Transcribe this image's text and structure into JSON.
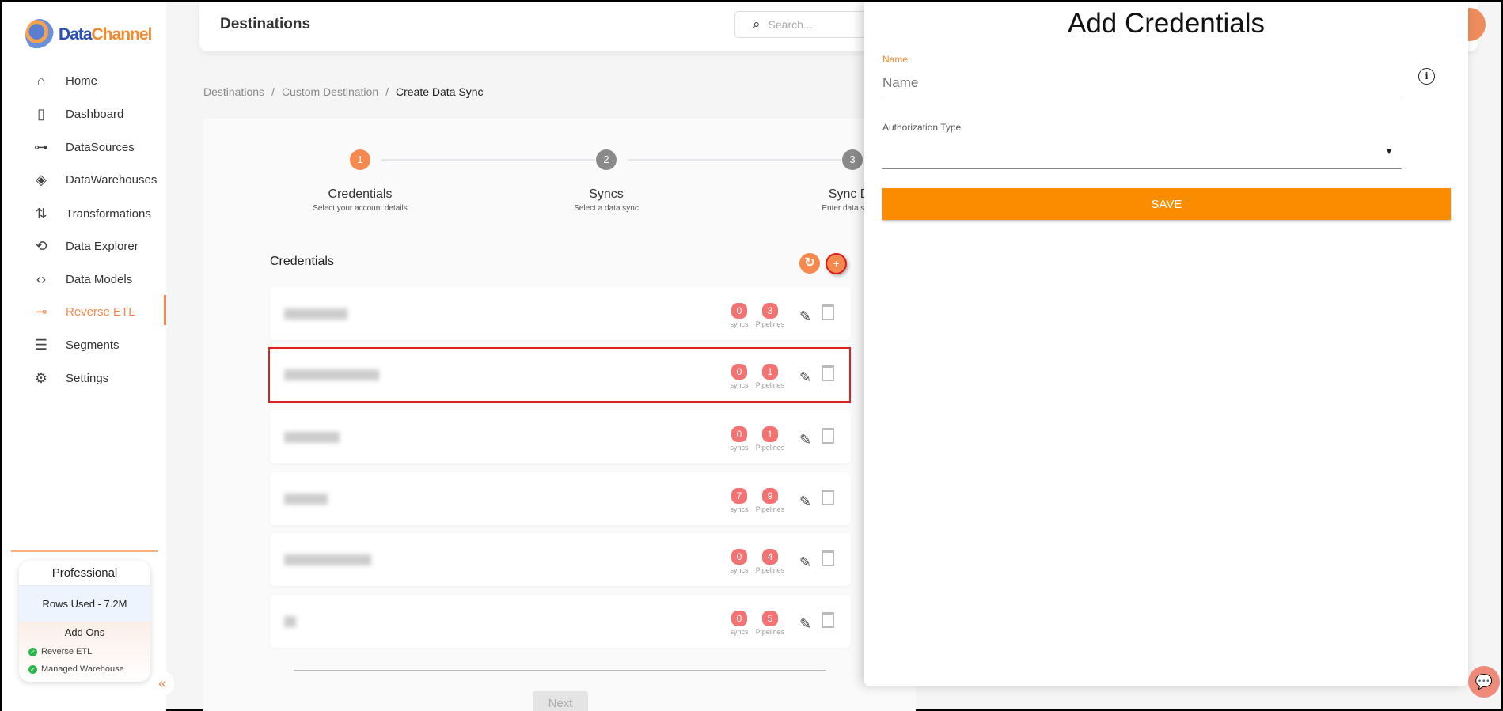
{
  "brand": {
    "name_a": "Data",
    "name_b": "Channel"
  },
  "sidebar": {
    "items": [
      {
        "label": "Home",
        "icon": "home-icon",
        "glyph": "⌂"
      },
      {
        "label": "Dashboard",
        "icon": "dashboard-icon",
        "glyph": "▯"
      },
      {
        "label": "DataSources",
        "icon": "datasources-icon",
        "glyph": "⊶"
      },
      {
        "label": "DataWarehouses",
        "icon": "layers-icon",
        "glyph": "◈"
      },
      {
        "label": "Transformations",
        "icon": "transform-icon",
        "glyph": "⇅"
      },
      {
        "label": "Data Explorer",
        "icon": "explorer-icon",
        "glyph": "⟲"
      },
      {
        "label": "Data Models",
        "icon": "data-models-icon",
        "glyph": "‹›"
      },
      {
        "label": "Reverse ETL",
        "icon": "reverse-etl-icon",
        "glyph": "⊸",
        "active": true
      },
      {
        "label": "Segments",
        "icon": "segments-icon",
        "glyph": "☰"
      },
      {
        "label": "Settings",
        "icon": "gear-icon",
        "glyph": "⚙"
      }
    ],
    "plan": {
      "title": "Professional",
      "rows_used": "Rows Used - 7.2M",
      "addons_title": "Add Ons",
      "addons": [
        "Reverse ETL",
        "Managed Warehouse"
      ]
    }
  },
  "header": {
    "title": "Destinations",
    "search_placeholder": "Search..."
  },
  "breadcrumb": [
    "Destinations",
    "/",
    "Custom Destination",
    "/",
    "Create Data Sync"
  ],
  "stepper": [
    {
      "num": "1",
      "label": "Credentials",
      "sub": "Select your account details",
      "active": true
    },
    {
      "num": "2",
      "label": "Syncs",
      "sub": "Select a data sync"
    },
    {
      "num": "3",
      "label": "Sync De",
      "sub": "Enter data sync c"
    }
  ],
  "credentials": {
    "title": "Credentials",
    "syncs_label": "syncs",
    "pipelines_label": "Pipelines",
    "rows": [
      {
        "syncs": "0",
        "pipelines": "3"
      },
      {
        "syncs": "0",
        "pipelines": "1",
        "highlighted": true
      },
      {
        "syncs": "0",
        "pipelines": "1"
      },
      {
        "syncs": "7",
        "pipelines": "9"
      },
      {
        "syncs": "0",
        "pipelines": "4"
      },
      {
        "syncs": "0",
        "pipelines": "5"
      }
    ]
  },
  "next_label": "Next",
  "panel": {
    "title": "Add Credentials",
    "name_label": "Name",
    "name_placeholder": "Name",
    "name_value": "",
    "auth_label": "Authorization Type",
    "auth_value": "",
    "save_label": "SAVE"
  },
  "colors": {
    "accent": "#f5894f",
    "save": "#fb8c00",
    "badge": "#f37373",
    "highlight": "#e02020"
  }
}
